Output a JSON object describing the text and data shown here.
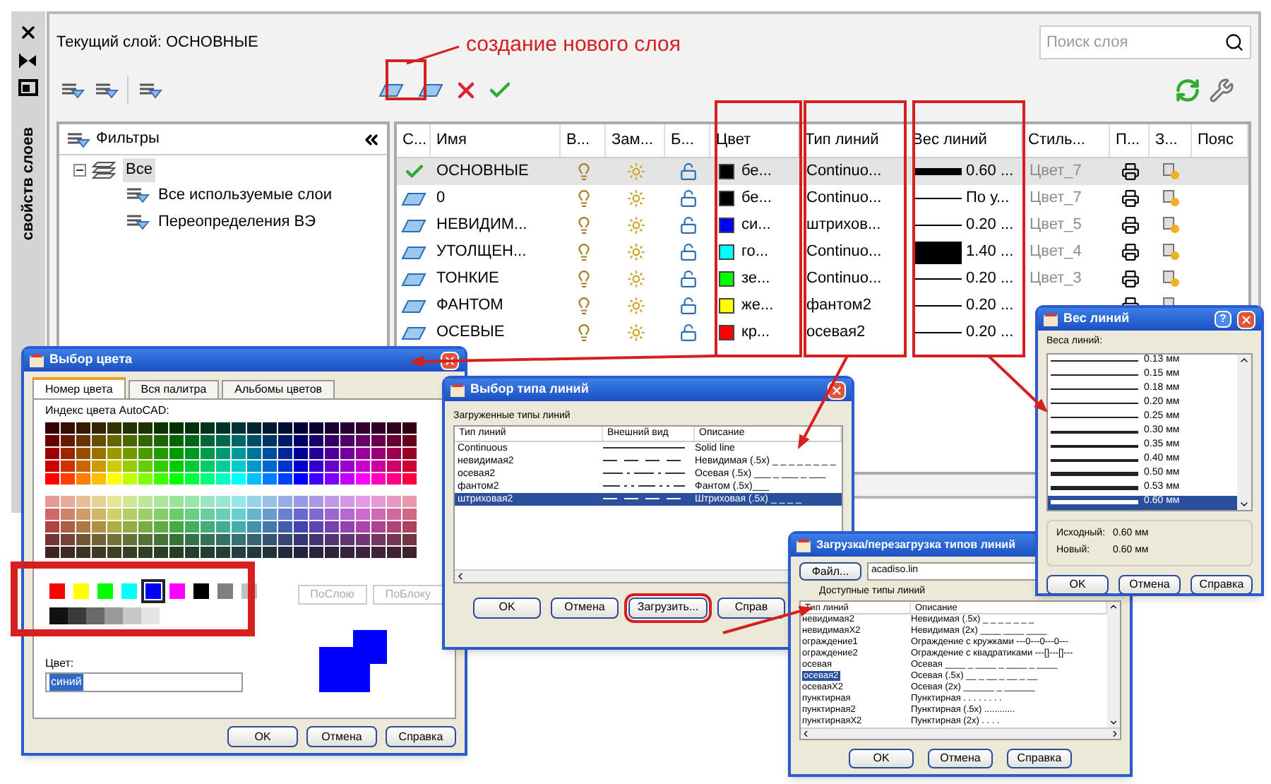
{
  "side_panel": {
    "title": "свойств слоев"
  },
  "manager": {
    "current_layer": "Текущий слой: ОСНОВНЫЕ",
    "annotation": "создание нового слоя",
    "search": {
      "placeholder": "Поиск слоя"
    },
    "filters": {
      "title": "Фильтры",
      "tree": [
        {
          "label": "Все",
          "expanded": true,
          "selected": true,
          "children": [
            {
              "label": "Все используемые слои",
              "selected": false
            },
            {
              "label": "Переопределения ВЭ",
              "selected": false
            }
          ]
        }
      ]
    },
    "columns": [
      "С...",
      "Имя",
      "В...",
      "Зам...",
      "Б...",
      "Цвет",
      "Тип линий",
      "Вес линий",
      "Стиль...",
      "П...",
      "З...",
      "Пояс"
    ],
    "rows": [
      {
        "current": true,
        "selected": true,
        "name": "ОСНОВНЫЕ",
        "color": "#000000",
        "color_name": "бе...",
        "linetype": "Continuo...",
        "kind": "medium",
        "weight": "0.60 ...",
        "style": "Цвет_7"
      },
      {
        "current": false,
        "selected": false,
        "name": "0",
        "color": "#000000",
        "color_name": "бе...",
        "linetype": "Continuo...",
        "kind": "thin",
        "weight": "По у...",
        "style": "Цвет_7"
      },
      {
        "current": false,
        "selected": false,
        "name": "НЕВИДИМ...",
        "color": "#0000ff",
        "color_name": "си...",
        "linetype": "штрихов...",
        "kind": "thin",
        "weight": "0.20 ...",
        "style": "Цвет_5"
      },
      {
        "current": false,
        "selected": false,
        "name": "УТОЛЩЕН...",
        "color": "#00ffff",
        "color_name": "го...",
        "linetype": "Continuo...",
        "kind": "heavy",
        "weight": "1.40 ...",
        "style": "Цвет_4"
      },
      {
        "current": false,
        "selected": false,
        "name": "ТОНКИЕ",
        "color": "#00ff00",
        "color_name": "зе...",
        "linetype": "Continuo...",
        "kind": "thin",
        "weight": "0.20 ...",
        "style": "Цвет_3"
      },
      {
        "current": false,
        "selected": false,
        "name": "ФАНТОМ",
        "color": "#ffff00",
        "color_name": "же...",
        "linetype": "фантом2",
        "kind": "thin",
        "weight": "0.20 ..."
      },
      {
        "current": false,
        "selected": false,
        "name": "ОСЕВЫЕ",
        "color": "#ff0000",
        "color_name": "кр...",
        "linetype": "осевая2",
        "kind": "thin",
        "weight": "0.20 ..."
      }
    ]
  },
  "color_dialog": {
    "title": "Выбор цвета",
    "tabs": [
      {
        "label": "Номер цвета",
        "selected": true
      },
      {
        "label": "Вся палитра",
        "selected": false
      },
      {
        "label": "Альбомы цветов",
        "selected": false
      }
    ],
    "index_label": "Индекс цвета AutoCAD:",
    "standard_colors": [
      {
        "color": "#ff0000",
        "selected": false
      },
      {
        "color": "#ffff00",
        "selected": false
      },
      {
        "color": "#00ff00",
        "selected": false
      },
      {
        "color": "#00ffff",
        "selected": false
      },
      {
        "color": "#0000ff",
        "selected": true
      },
      {
        "color": "#ff00ff",
        "selected": false
      },
      {
        "color": "#000000",
        "selected": false
      },
      {
        "color": "#808080",
        "selected": false
      },
      {
        "color": "#c0c0c0",
        "selected": false
      }
    ],
    "gray_colors": [
      {
        "color": "#111111"
      },
      {
        "color": "#3a3a3a"
      },
      {
        "color": "#6a6a6a"
      },
      {
        "color": "#9a9a9a"
      },
      {
        "color": "#c8c8c8"
      },
      {
        "color": "#e4e4e4"
      }
    ],
    "bylayer": {
      "label": "ПоСлою",
      "disabled": true
    },
    "byblock": {
      "label": "ПоБлоку",
      "disabled": true
    },
    "color_label": "Цвет:",
    "color_value": "синий",
    "buttons": [
      "OK",
      "Отмена",
      "Справка"
    ]
  },
  "linetype_dialog": {
    "title": "Выбор типа линий",
    "list_label": "Загруженные типы линий",
    "columns": [
      "Тип линий",
      "Внешний вид",
      "Описание"
    ],
    "rows": [
      {
        "name": "Continuous",
        "kind": "solid",
        "description": "Solid line",
        "selected": false
      },
      {
        "name": "невидимая2",
        "kind": "dashed",
        "description": "Невидимая (.5x) _ _ _ _ _ _ _ _",
        "selected": false
      },
      {
        "name": "осевая2",
        "kind": "dashdot",
        "description": "Осевая (.5x) ___ _ ___ _ ___",
        "selected": false
      },
      {
        "name": "фантом2",
        "kind": "phantom",
        "description": "Фантом (.5x)___",
        "selected": false
      },
      {
        "name": "штриховая2",
        "kind": "dashed",
        "description": "Штриховая (.5x) _ _ _ _",
        "selected": true
      }
    ],
    "buttons": [
      {
        "label": "OK",
        "highlighted": false
      },
      {
        "label": "Отмена",
        "highlighted": false
      },
      {
        "label": "Загрузить...",
        "highlighted": true
      },
      {
        "label": "Справ",
        "highlighted": false
      }
    ]
  },
  "load_dialog": {
    "title": "Загрузка/перезагрузка типов линий",
    "file_button": "Файл...",
    "file_value": "acadiso.lin",
    "list_label": "Доступные типы линий",
    "columns": [
      "Тип линий",
      "Описание"
    ],
    "rows": [
      {
        "name": "невидимая2",
        "description": "Невидимая (.5x) _ _ _ _ _ _ _",
        "selected": false
      },
      {
        "name": "невидимаяX2",
        "description": "Невидимая (2x) ____  ____  ____",
        "selected": false
      },
      {
        "name": "ограждение1",
        "description": "Ограждение с кружками ---0---0---0---",
        "selected": false
      },
      {
        "name": "ограждение2",
        "description": "Ограждение с квадратиками ---[]---[]---",
        "selected": false
      },
      {
        "name": "осевая",
        "description": "Осевая ____ _ ____ _ ____ _ ____",
        "selected": false
      },
      {
        "name": "осевая2",
        "description": "Осевая (.5x) __ _ __ _ __ _ __",
        "selected": true
      },
      {
        "name": "осеваяX2",
        "description": "Осевая (2x) ______  _  ______",
        "selected": false
      },
      {
        "name": "пунктирная",
        "description": "Пунктирная . . . . . . . .",
        "selected": false
      },
      {
        "name": "пунктирная2",
        "description": "Пунктирная (.5x) ............",
        "selected": false
      },
      {
        "name": "пунктирнаяX2",
        "description": "Пунктирная (2x) .  .  .  .",
        "selected": false
      }
    ],
    "buttons": [
      "OK",
      "Отмена",
      "Справка"
    ]
  },
  "lineweight_dialog": {
    "title": "Вес линий",
    "help_button": "?",
    "list_label": "Веса линий:",
    "items": [
      {
        "label": "0.13 мм",
        "kind": "thin",
        "selected": false
      },
      {
        "label": "0.15 мм",
        "kind": "thin",
        "selected": false
      },
      {
        "label": "0.18 мм",
        "kind": "thin",
        "selected": false
      },
      {
        "label": "0.20 мм",
        "kind": "thin",
        "selected": false
      },
      {
        "label": "0.25 мм",
        "kind": "thin",
        "selected": false
      },
      {
        "label": "0.30 мм",
        "kind": "medium",
        "selected": false
      },
      {
        "label": "0.35 мм",
        "kind": "medium",
        "selected": false
      },
      {
        "label": "0.40 мм",
        "kind": "medium",
        "selected": false
      },
      {
        "label": "0.50 мм",
        "kind": "thick",
        "selected": false
      },
      {
        "label": "0.53 мм",
        "kind": "thick",
        "selected": false
      },
      {
        "label": "0.60 мм",
        "kind": "thick",
        "selected": true
      }
    ],
    "original_label": "Исходный:",
    "original_value": "0.60 мм",
    "new_label": "Новый:",
    "new_value": "0.60 мм",
    "buttons": [
      "OK",
      "Отмена",
      "Справка"
    ]
  }
}
